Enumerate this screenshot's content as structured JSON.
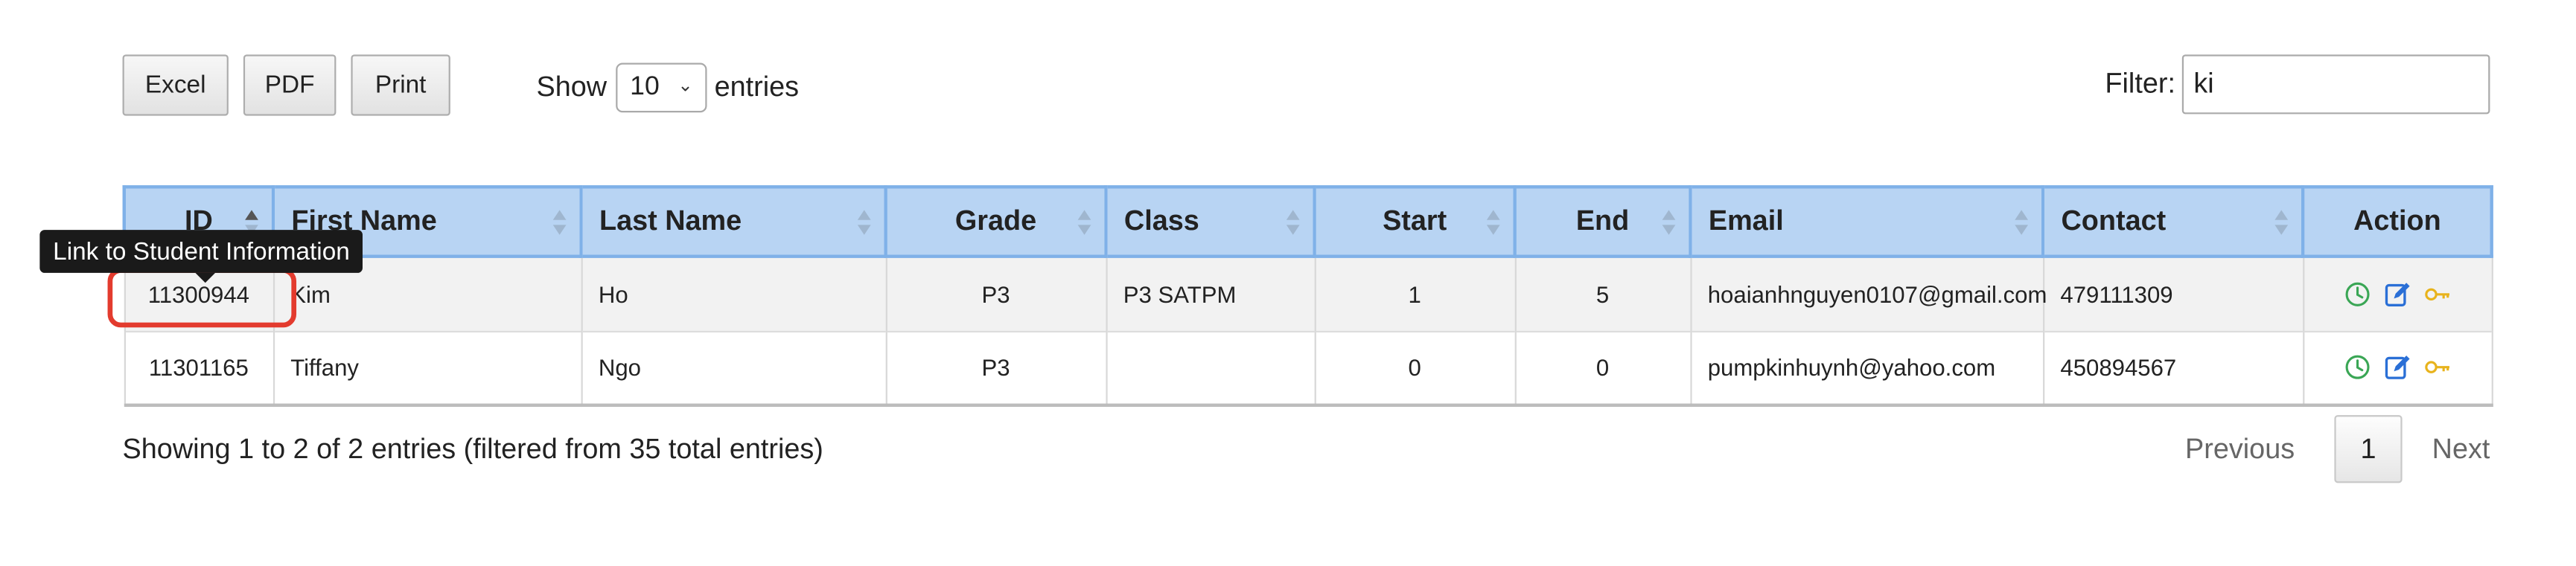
{
  "toolbar": {
    "excel_label": "Excel",
    "pdf_label": "PDF",
    "print_label": "Print"
  },
  "length_menu": {
    "prefix": "Show",
    "selected": "10",
    "suffix": "entries"
  },
  "filter": {
    "label": "Filter:",
    "value": "ki"
  },
  "table": {
    "headers": {
      "id": "ID",
      "first_name": "First Name",
      "last_name": "Last Name",
      "grade": "Grade",
      "class": "Class",
      "start": "Start",
      "end": "End",
      "email": "Email",
      "contact": "Contact",
      "action": "Action"
    },
    "rows": [
      {
        "id": "11300944",
        "first_name": "Kim",
        "last_name": "Ho",
        "grade": "P3",
        "class": "P3 SATPM",
        "start": "1",
        "end": "5",
        "email": "hoaianhnguyen0107@gmail.com",
        "contact": "479111309"
      },
      {
        "id": "11301165",
        "first_name": "Tiffany",
        "last_name": "Ngo",
        "grade": "P3",
        "class": "",
        "start": "0",
        "end": "0",
        "email": "pumpkinhuynh@yahoo.com",
        "contact": "450894567"
      }
    ]
  },
  "info": "Showing 1 to 2 of 2 entries (filtered from 35 total entries)",
  "pagination": {
    "previous": "Previous",
    "current_page": "1",
    "next": "Next"
  },
  "tooltip": {
    "text": "Link to Student Information"
  },
  "icons": {
    "history": "clock-icon",
    "edit": "edit-icon",
    "password": "key-icon"
  },
  "colors": {
    "header_bg": "#b8d4f3",
    "header_border": "#7fb1e8",
    "highlight": "#e33b2e",
    "clock": "#3aa655",
    "edit": "#2a6fd6",
    "key": "#e8b31c"
  }
}
